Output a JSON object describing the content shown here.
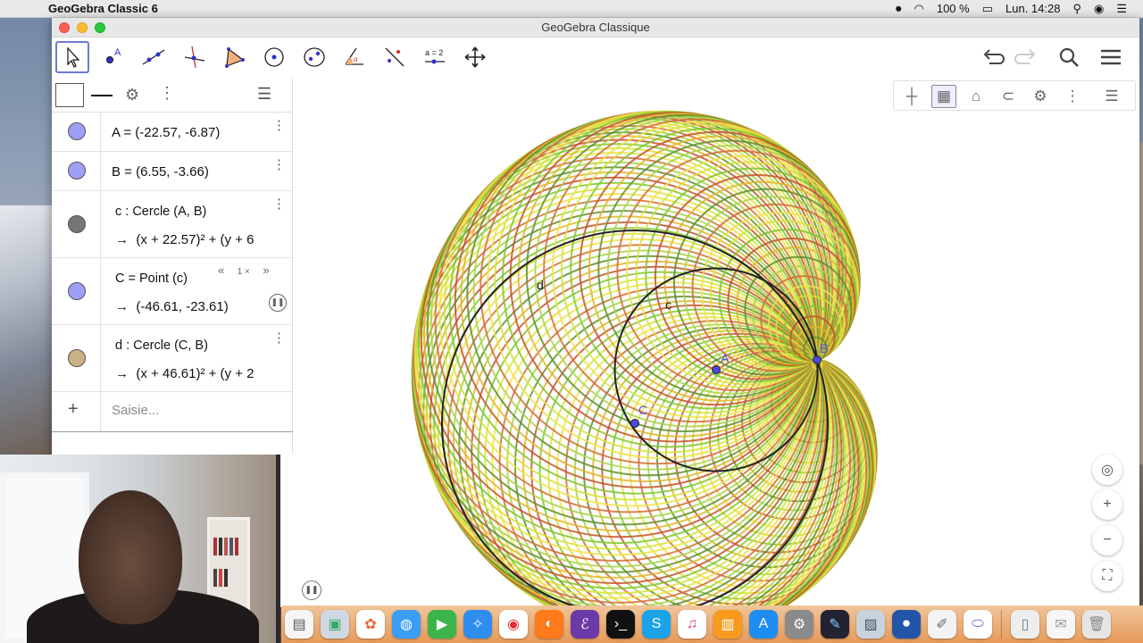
{
  "menubar": {
    "app_name": "GeoGebra Classic 6",
    "battery": "100 %",
    "clock": "Lun. 14:28"
  },
  "window": {
    "title": "GeoGebra Classique"
  },
  "toolbar": {
    "tools": [
      {
        "name": "move-tool",
        "active": true
      },
      {
        "name": "point-tool",
        "active": false
      },
      {
        "name": "line-tool",
        "active": false
      },
      {
        "name": "perpendicular-line-tool",
        "active": false
      },
      {
        "name": "polygon-tool",
        "active": false
      },
      {
        "name": "circle-center-point-tool",
        "active": false
      },
      {
        "name": "ellipse-tool",
        "active": false
      },
      {
        "name": "angle-tool",
        "active": false
      },
      {
        "name": "reflect-tool",
        "active": false
      },
      {
        "name": "slider-tool",
        "active": false,
        "label": "a = 2"
      },
      {
        "name": "move-graphics-view-tool",
        "active": false
      }
    ]
  },
  "algebra": {
    "rows": [
      {
        "text": "A = (-22.57, -6.87)",
        "marble_color": "#9f9ff6"
      },
      {
        "text": "B = (6.55, -3.66)",
        "marble_color": "#9f9ff6"
      },
      {
        "definition": "c : Cercle (A, B)",
        "value": "(x + 22.57)² + (y + 6",
        "marble_color": "#767676"
      },
      {
        "definition": "C = Point (c)",
        "value": "(-46.61, -23.61)",
        "marble_color": "#9f9ff6",
        "speed": "1 ×"
      },
      {
        "definition": "d : Cercle (C, B)",
        "value": "(x + 46.61)² + (y + 2",
        "marble_color": "#c9b183"
      }
    ],
    "input_placeholder": "Saisie..."
  },
  "graphics": {
    "labels": {
      "A": "A",
      "B": "B",
      "C": "C",
      "c": "c",
      "d": "d"
    },
    "trace_colors": [
      "#d6e23a",
      "#7fc72e",
      "#c4542e",
      "#e0b52c",
      "#5f8f2a",
      "#a8d44a",
      "#d46d36",
      "#f0e24a"
    ]
  },
  "dock": {
    "apps": [
      "finder-icon",
      "preview-icon",
      "photos-icon",
      "messages-icon",
      "facetime-icon",
      "safari-icon",
      "chrome-icon",
      "firefox-icon",
      "emacs-icon",
      "terminal-icon",
      "skype-icon",
      "itunes-icon",
      "books-icon",
      "app-store-icon",
      "system-preferences-icon",
      "ibooks-author-icon",
      "image-capture-icon",
      "screen-recorder-icon",
      "textedit-icon",
      "geogebra-icon",
      "files-icon",
      "mail-icon",
      "trash-icon"
    ]
  }
}
